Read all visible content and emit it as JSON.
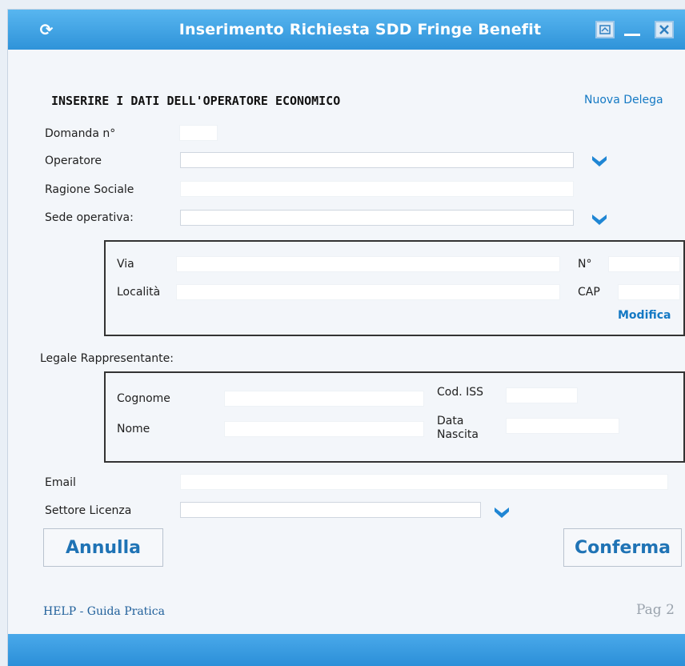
{
  "window": {
    "title": "Inserimento Richiesta SDD Fringe Benefit",
    "app_icon": "refresh-icon",
    "controls": [
      "restore-icon",
      "minimize-icon",
      "close-icon"
    ],
    "accent": "#2f93d9"
  },
  "form": {
    "section_title": "INSERIRE I DATI DELL'OPERATORE ECONOMICO",
    "new_delegation_link": "Nuova Delega",
    "domanda_label": "Domanda n°",
    "domanda_value": "",
    "operatore_label": "Operatore",
    "operatore_value": "",
    "ragione_sociale_label": "Ragione Sociale",
    "ragione_sociale_value": "",
    "sede_label": "Sede operativa:",
    "sede_value": "",
    "address": {
      "via_label": "Via",
      "via_value": "",
      "numero_label": "N°",
      "numero_value": "",
      "localita_label": "Località",
      "localita_value": "",
      "cap_label": "CAP",
      "cap_value": "",
      "modifica_link": "Modifica"
    },
    "legale_label": "Legale Rappresentante:",
    "legale": {
      "cognome_label": "Cognome",
      "cognome_value": "",
      "cod_iss_label": "Cod. ISS",
      "cod_iss_value": "",
      "nome_label": "Nome",
      "nome_value": "",
      "data_label_1": "Data",
      "data_label_2": "Nascita",
      "data_value": ""
    },
    "email_label": "Email",
    "email_value": "",
    "settore_label": "Settore Licenza",
    "settore_value": ""
  },
  "actions": {
    "cancel": "Annulla",
    "confirm": "Conferma"
  },
  "footer": {
    "help": "HELP - Guida Pratica",
    "page": "Pag 2"
  }
}
